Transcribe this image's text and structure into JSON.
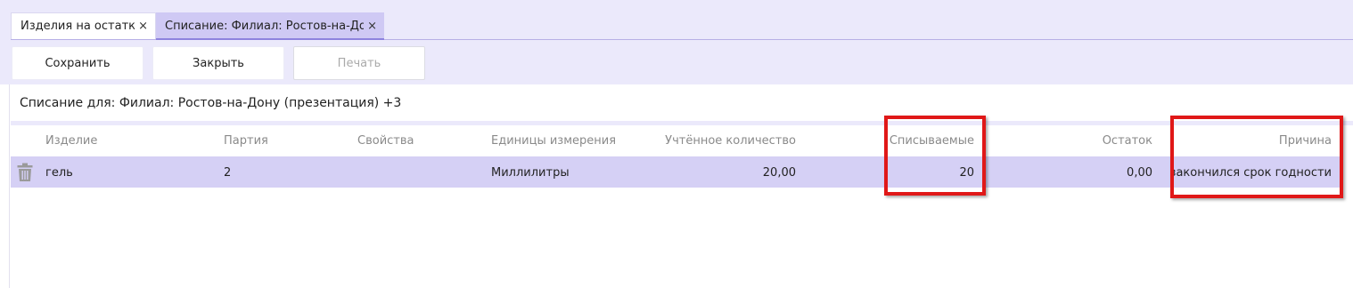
{
  "tabs": [
    {
      "label": "Изделия на остатке",
      "close": "×"
    },
    {
      "label": "Списание: Филиал: Ростов-на-До...",
      "close": "×"
    }
  ],
  "toolbar": {
    "save": "Сохранить",
    "close": "Закрыть",
    "print": "Печать"
  },
  "header": {
    "title": "Списание для: Филиал: Ростов-на-Дону (презентация) +3"
  },
  "table": {
    "columns": {
      "product": "Изделие",
      "batch": "Партия",
      "properties": "Свойства",
      "units": "Единицы измерения",
      "counted": "Учтённое количество",
      "writeoff": "Списываемые",
      "remainder": "Остаток",
      "reason": "Причина"
    },
    "rows": [
      {
        "product": "гель",
        "batch": "2",
        "properties": "",
        "units": "Миллилитры",
        "counted": "20,00",
        "writeoff": "20",
        "remainder": "0,00",
        "reason": "закончился срок годности"
      }
    ]
  },
  "colors": {
    "accent": "#8e83de",
    "row_selected": "#d5d0f5",
    "highlight": "#e01818",
    "toolbar_bg": "#ebe9fb"
  },
  "icons": {
    "delete": "trash-icon",
    "tab_close": "close-icon"
  }
}
